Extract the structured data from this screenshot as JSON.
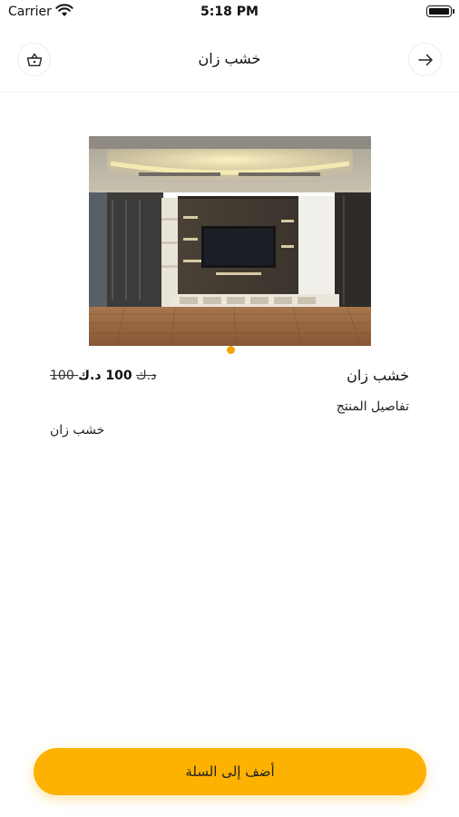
{
  "status_bar": {
    "carrier": "Carrier",
    "time": "5:18 PM"
  },
  "nav": {
    "title": "خشب زان",
    "left_icon": "shopping-basket-icon",
    "right_icon": "arrow-right-icon"
  },
  "product": {
    "name": "خشب زان",
    "price": "100 د.ك",
    "old_price": "100 د.ك",
    "details_heading": "تفاصيل المنتج",
    "description": "خشب زان",
    "image": "living-room-tv-wall-photo",
    "carousel_pages": 1,
    "carousel_active": 1
  },
  "actions": {
    "add_to_cart_label": "أضف إلى السلة"
  },
  "colors": {
    "accent": "#fdb201",
    "dot": "#f5a500"
  }
}
